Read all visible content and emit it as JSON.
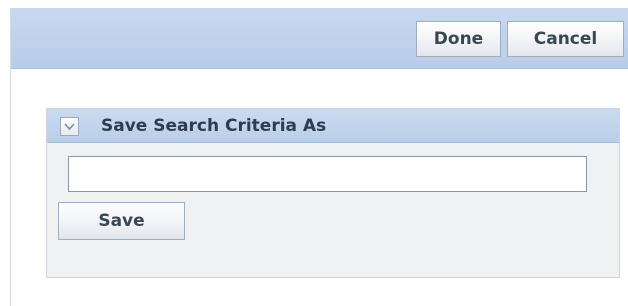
{
  "toolbar": {
    "done_label": "Done",
    "cancel_label": "Cancel"
  },
  "save_panel": {
    "title": "Save Search Criteria As",
    "disclosure_icon": "chevron-down-icon",
    "name_input": {
      "value": "",
      "placeholder": ""
    },
    "save_label": "Save"
  },
  "colors": {
    "header_background": "#b8cde8",
    "panel_background": "#f0f1f3",
    "button_text": "#3a4654"
  }
}
